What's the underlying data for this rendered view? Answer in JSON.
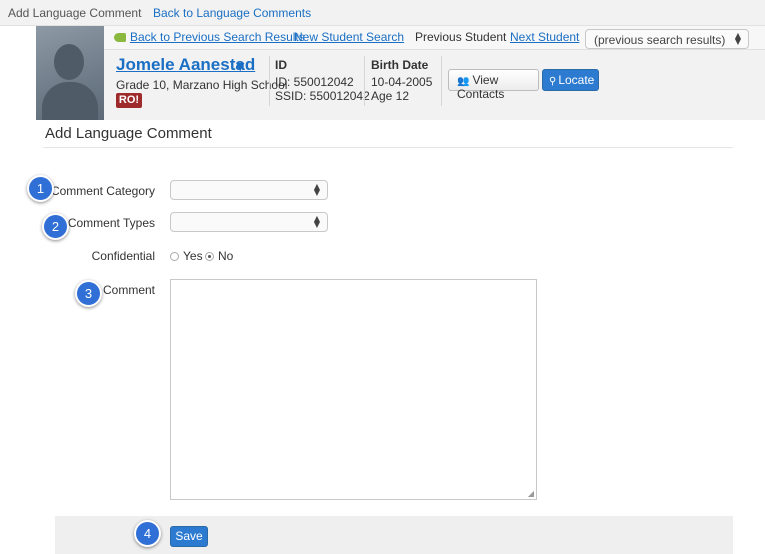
{
  "topnav": {
    "current": "Add Language Comment",
    "back_link": "Back to Language Comments"
  },
  "navrow": {
    "back_results": "Back to Previous Search Results",
    "new_search": "New Student Search",
    "previous_student": "Previous Student",
    "next_student": "Next Student",
    "search_select": "(previous search results)"
  },
  "student": {
    "name": "Jomele Aanestad",
    "grade_school": "Grade 10, Marzano High School",
    "badge": "RO!",
    "id_label": "ID",
    "id_value": "ID: 550012042",
    "ssid": "SSID: 550012042",
    "birth_label": "Birth Date",
    "birth_value": "10-04-2005",
    "age": "Age 12",
    "view_contacts": "View Contacts",
    "locate": "Locate"
  },
  "page_title": "Add Language Comment",
  "form": {
    "comment_category_label": "Comment Category",
    "comment_category_value": "",
    "comment_types_label": "Comment Types",
    "comment_types_value": "",
    "confidential_label": "Confidential",
    "yes_label": "Yes",
    "no_label": "No",
    "confidential_selected": "No",
    "comment_label": "Comment",
    "comment_value": "",
    "save_label": "Save"
  },
  "callouts": [
    "1",
    "2",
    "3",
    "4"
  ],
  "colors": {
    "link": "#1a6fc4",
    "primary_button": "#2d7bd0",
    "badge": "#9e2a2b",
    "callout": "#2f6fd6"
  }
}
